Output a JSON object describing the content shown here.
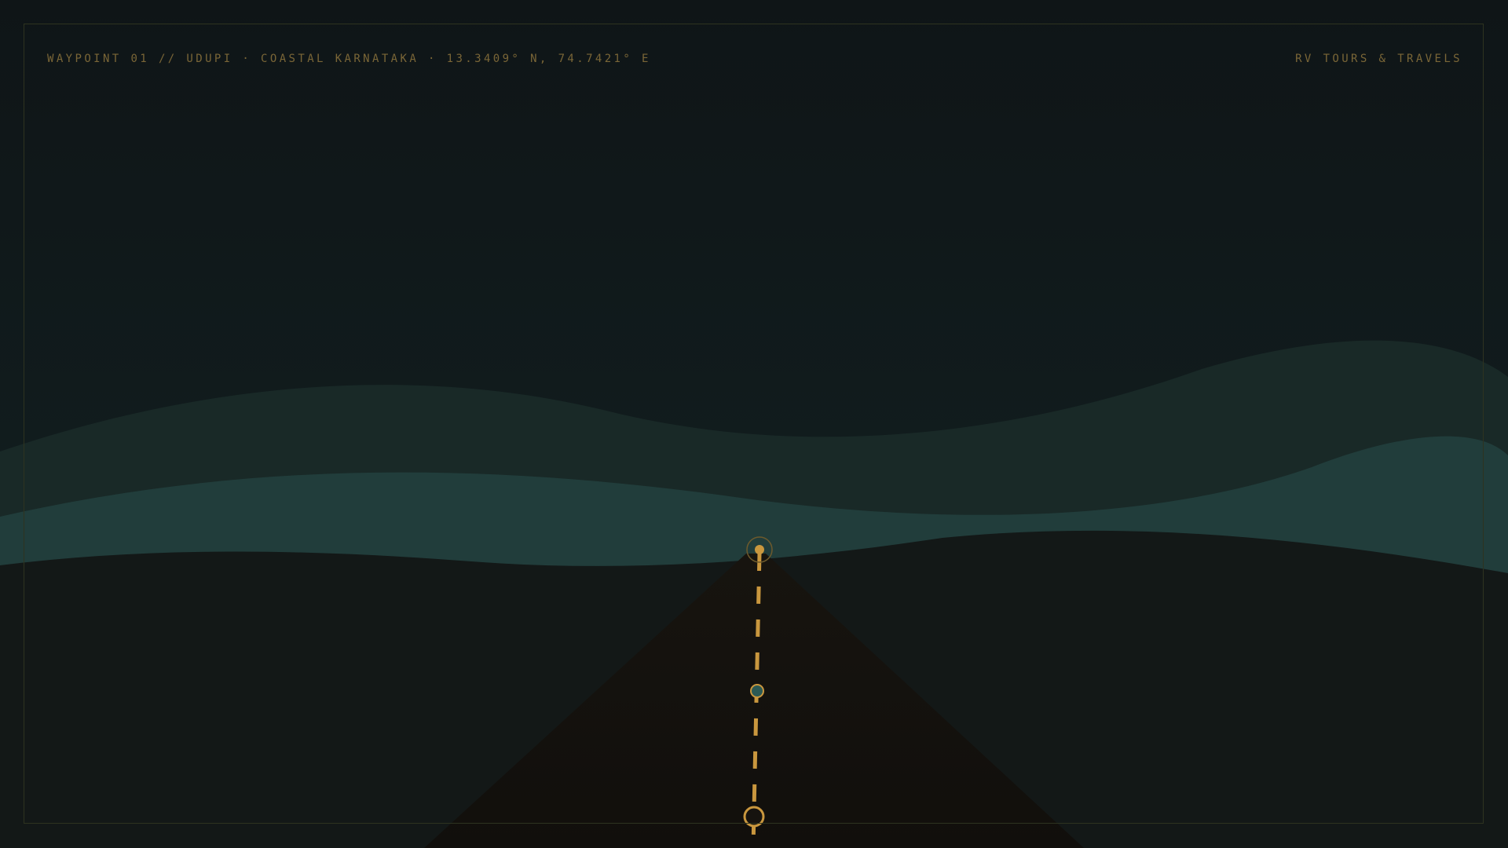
{
  "header": {
    "waypoint_label": "WAYPOINT 01 // UDUPI · COASTAL KARNATAKA · 13.3409° N, 74.7421° E",
    "brand": "RV TOURS & TRAVELS"
  },
  "colors": {
    "background": "#0f1517",
    "far_hills": "#192927",
    "near_hills": "#213d3b",
    "ground": "#131817",
    "road": "#16130f",
    "accent_gold": "#c9973e",
    "marker_teal": "#2c5a55",
    "frame": "#2e3320"
  },
  "route": {
    "markers": [
      "destination-marker",
      "midpoint-marker",
      "origin-marker"
    ]
  }
}
